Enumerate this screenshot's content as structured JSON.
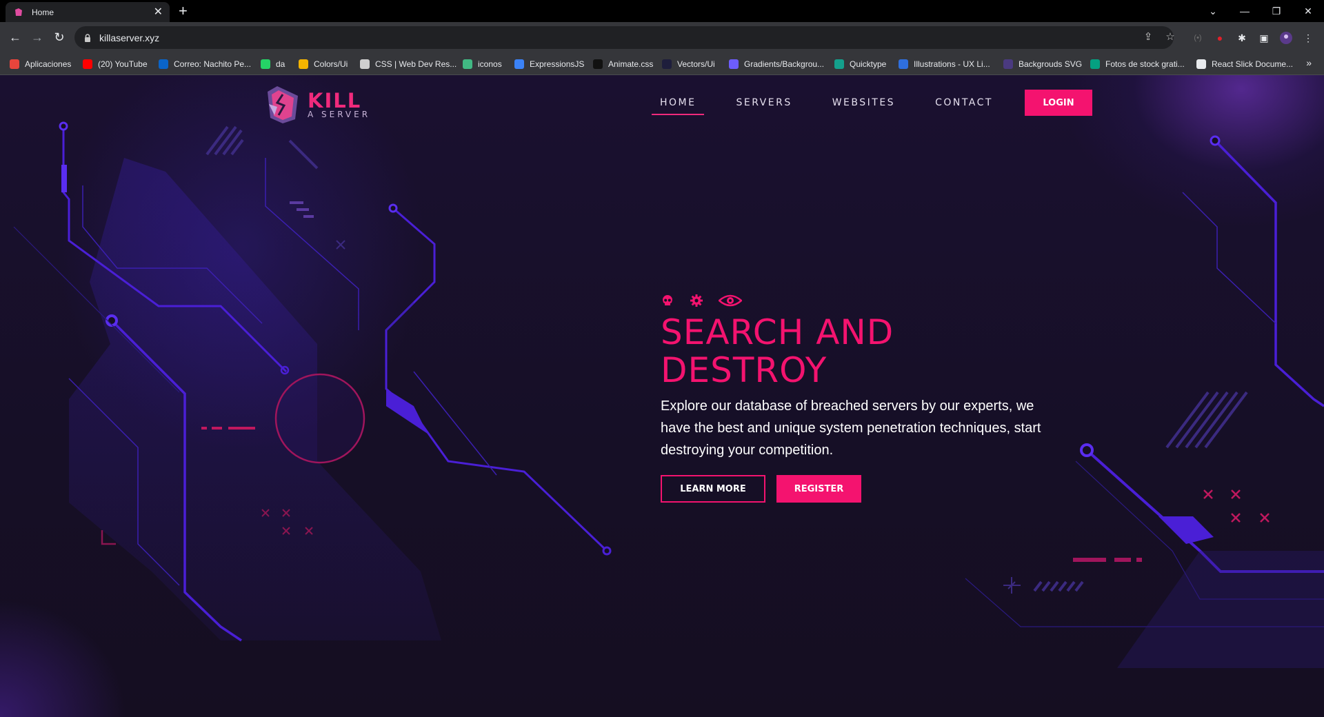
{
  "browser": {
    "tab_title": "Home",
    "url": "killaserver.xyz",
    "bookmarks": [
      {
        "label": "Aplicaciones",
        "icon": "apps-grid-icon",
        "color": "#e8453c"
      },
      {
        "label": "(20) YouTube",
        "icon": "youtube-icon",
        "color": "#ff0000"
      },
      {
        "label": "Correo: Nachito Pe...",
        "icon": "outlook-icon",
        "color": "#0a64c8"
      },
      {
        "label": "da",
        "icon": "whatsapp-icon",
        "color": "#25d366"
      },
      {
        "label": "Colors/Ui",
        "icon": "colors-icon",
        "color": "#f4b400"
      },
      {
        "label": "CSS | Web Dev Res...",
        "icon": "save-icon",
        "color": "#cfcfcf"
      },
      {
        "label": "iconos",
        "icon": "vue-icon",
        "color": "#41b883"
      },
      {
        "label": "ExpressionsJS",
        "icon": "expressions-icon",
        "color": "#3b82f6"
      },
      {
        "label": "Animate.css",
        "icon": "animate-icon",
        "color": "#111111"
      },
      {
        "label": "Vectors/Ui",
        "icon": "vectors-icon",
        "color": "#1e1e3c"
      },
      {
        "label": "Gradients/Backgrou...",
        "icon": "gradients-icon",
        "color": "#6d5dfc"
      },
      {
        "label": "Quicktype",
        "icon": "quicktype-icon",
        "color": "#14a08c"
      },
      {
        "label": "Illustrations - UX Li...",
        "icon": "ux-icon",
        "color": "#2f6fde"
      },
      {
        "label": "Backgrouds SVG",
        "icon": "svg-icon",
        "color": "#4a3a80"
      },
      {
        "label": "Fotos de stock grati...",
        "icon": "photos-icon",
        "color": "#05a081"
      },
      {
        "label": "React Slick Docume...",
        "icon": "react-icon",
        "color": "#e8eaed"
      }
    ]
  },
  "site": {
    "logo_main": "KILL",
    "logo_sub": "A SERVER",
    "nav": [
      {
        "label": "HOME",
        "active": true
      },
      {
        "label": "SERVERS",
        "active": false
      },
      {
        "label": "WEBSITES",
        "active": false
      },
      {
        "label": "CONTACT",
        "active": false
      }
    ],
    "login_label": "LOGIN"
  },
  "hero": {
    "icons": [
      "skull-icon",
      "gear-icon",
      "eye-icon"
    ],
    "title_line1": "SEARCH AND",
    "title_line2": "DESTROY",
    "text": "Explore our database of breached servers by our experts, we have the best and unique system penetration techniques, start destroying your competition.",
    "learn_more_label": "LEARN MORE",
    "register_label": "REGISTER"
  },
  "colors": {
    "accent": "#f4136f",
    "background": "#160f24",
    "circuit": "#4a1fd6"
  }
}
